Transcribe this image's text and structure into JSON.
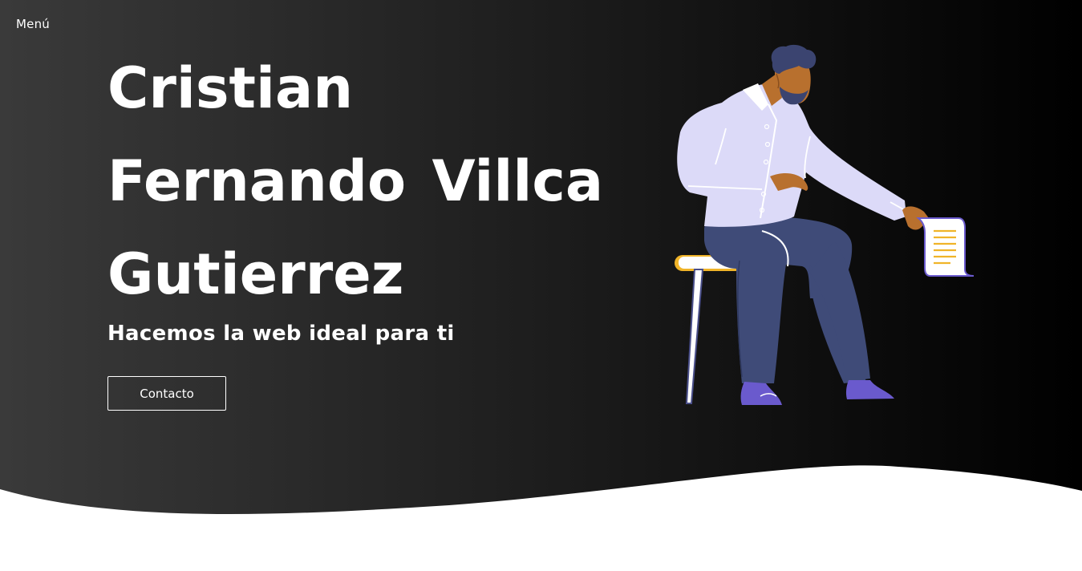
{
  "nav": {
    "menu_label": "Menú"
  },
  "hero": {
    "title": "Cristian Fernando Villca Gutierrez",
    "subtitle": "Hacemos la web ideal para ti",
    "contact_label": "Contacto"
  },
  "colors": {
    "background_gradient_start": "#3a3a3a",
    "background_gradient_end": "#000000",
    "text": "#ffffff",
    "shirt": "#dcdaf8",
    "pants": "#3f4b78",
    "shoes": "#6a5acd",
    "skin": "#b8702e",
    "hair": "#3b4470",
    "stool_seat": "#f0b429",
    "document_lines": "#f0b429",
    "wave": "#ffffff"
  },
  "illustration": {
    "name": "man-sitting-reading-document-illustration"
  }
}
